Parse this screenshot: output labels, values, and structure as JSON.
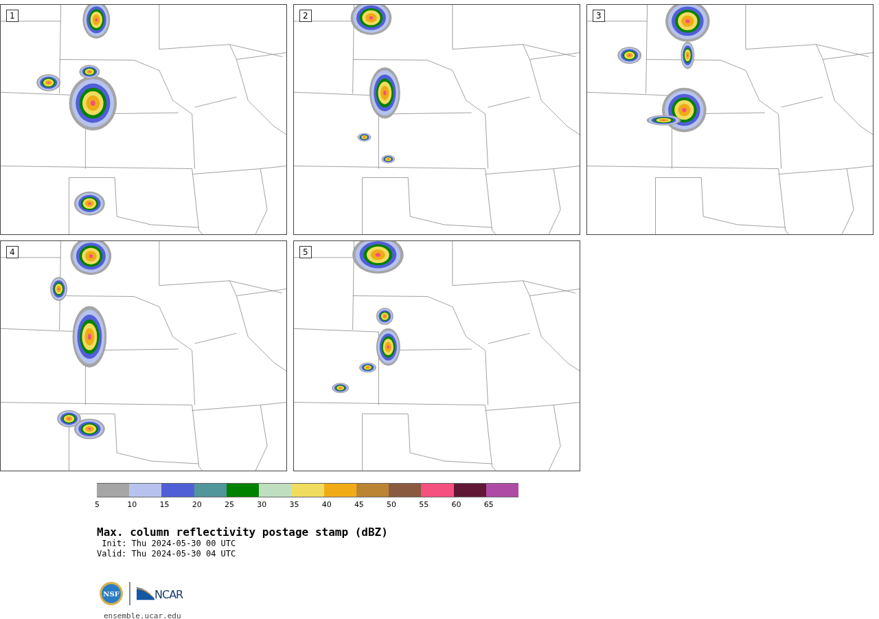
{
  "panels": [
    {
      "number": "1"
    },
    {
      "number": "2"
    },
    {
      "number": "3"
    },
    {
      "number": "4"
    },
    {
      "number": "5"
    }
  ],
  "colorbar": [
    {
      "color": "#a5a5a5",
      "label": "5"
    },
    {
      "color": "#b7c3ee",
      "label": "10"
    },
    {
      "color": "#515fd6",
      "label": "15"
    },
    {
      "color": "#50969b",
      "label": "20"
    },
    {
      "color": "#008100",
      "label": "25"
    },
    {
      "color": "#c0dfc0",
      "label": "30"
    },
    {
      "color": "#f0dc5e",
      "label": "35"
    },
    {
      "color": "#f0ab17",
      "label": "40"
    },
    {
      "color": "#bb8433",
      "label": "45"
    },
    {
      "color": "#8a5a40",
      "label": "50"
    },
    {
      "color": "#f45080",
      "label": "55"
    },
    {
      "color": "#611836",
      "label": "60"
    },
    {
      "color": "#ae4ca5",
      "label": "65"
    }
  ],
  "title": "Max. column reflectivity postage stamp (dBZ)",
  "times": [
    {
      "label": "Init:",
      "value": "Thu 2024-05-30 00 UTC"
    },
    {
      "label": "Valid:",
      "value": "Thu 2024-05-30 04 UTC"
    }
  ],
  "logos": {
    "nsf": "NSF",
    "ncar": "NCAR"
  },
  "url": "ensemble.ucar.edu"
}
